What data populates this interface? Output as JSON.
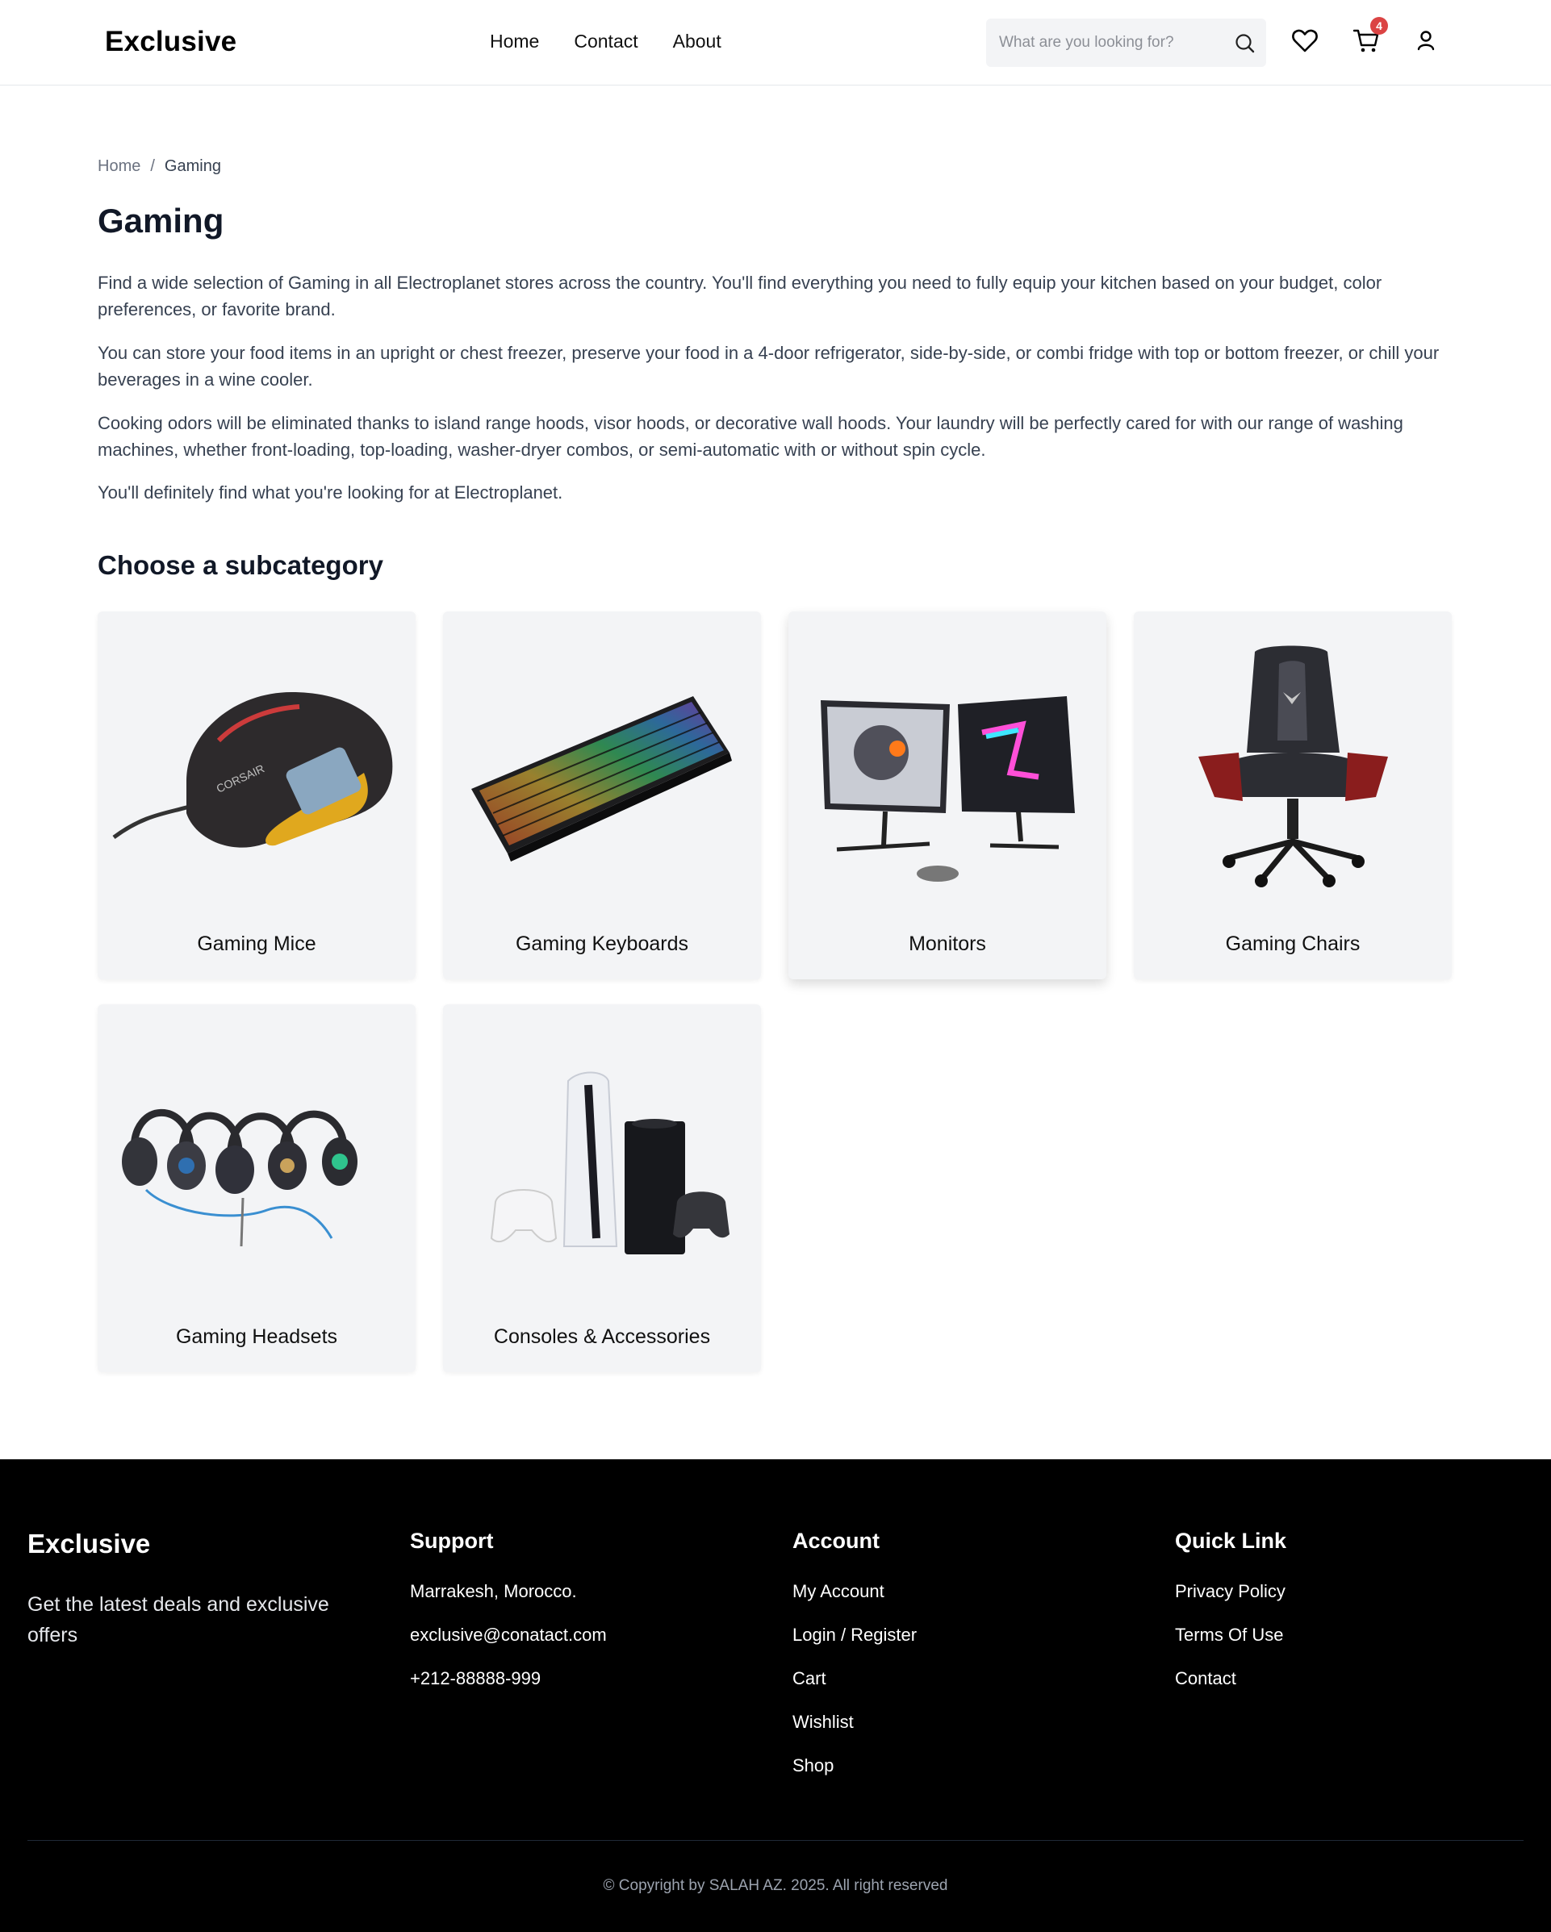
{
  "header": {
    "logo": "Exclusive",
    "nav": [
      "Home",
      "Contact",
      "About"
    ],
    "search_placeholder": "What are you looking for?",
    "cart_count": "4"
  },
  "breadcrumb": {
    "home": "Home",
    "separator": "/",
    "current": "Gaming"
  },
  "page": {
    "title": "Gaming",
    "paragraphs": [
      "Find a wide selection of Gaming in all Electroplanet stores across the country. You'll find everything you need to fully equip your kitchen based on your budget, color preferences, or favorite brand.",
      "You can store your food items in an upright or chest freezer, preserve your food in a 4-door refrigerator, side-by-side, or combi fridge with top or bottom freezer, or chill your beverages in a wine cooler.",
      "Cooking odors will be eliminated thanks to island range hoods, visor hoods, or decorative wall hoods. Your laundry will be perfectly cared for with our range of washing machines, whether front-loading, top-loading, washer-dryer combos, or semi-automatic with or without spin cycle.",
      "You'll definitely find what you're looking for at Electroplanet."
    ],
    "subcategory_heading": "Choose a subcategory",
    "subcategories": [
      {
        "label": "Gaming Mice",
        "icon": "gaming-mouse-image"
      },
      {
        "label": "Gaming Keyboards",
        "icon": "gaming-keyboard-image"
      },
      {
        "label": "Monitors",
        "icon": "monitors-image"
      },
      {
        "label": "Gaming Chairs",
        "icon": "gaming-chair-image"
      },
      {
        "label": "Gaming Headsets",
        "icon": "gaming-headsets-image"
      },
      {
        "label": "Consoles & Accessories",
        "icon": "consoles-image"
      }
    ]
  },
  "footer": {
    "logo": "Exclusive",
    "tagline": "Get the latest deals and exclusive offers",
    "support": {
      "title": "Support",
      "items": [
        "Marrakesh, Morocco.",
        "exclusive@conatact.com",
        "+212-88888-999"
      ]
    },
    "account": {
      "title": "Account",
      "items": [
        "My Account",
        "Login / Register",
        "Cart",
        "Wishlist",
        "Shop"
      ]
    },
    "quick": {
      "title": "Quick Link",
      "items": [
        "Privacy Policy",
        "Terms Of Use",
        "Contact"
      ]
    },
    "copyright": "© Copyright by SALAH AZ. 2025. All right reserved"
  },
  "colors": {
    "accent": "#db4444",
    "card_bg": "#f3f4f6",
    "footer_bg": "#000000"
  }
}
